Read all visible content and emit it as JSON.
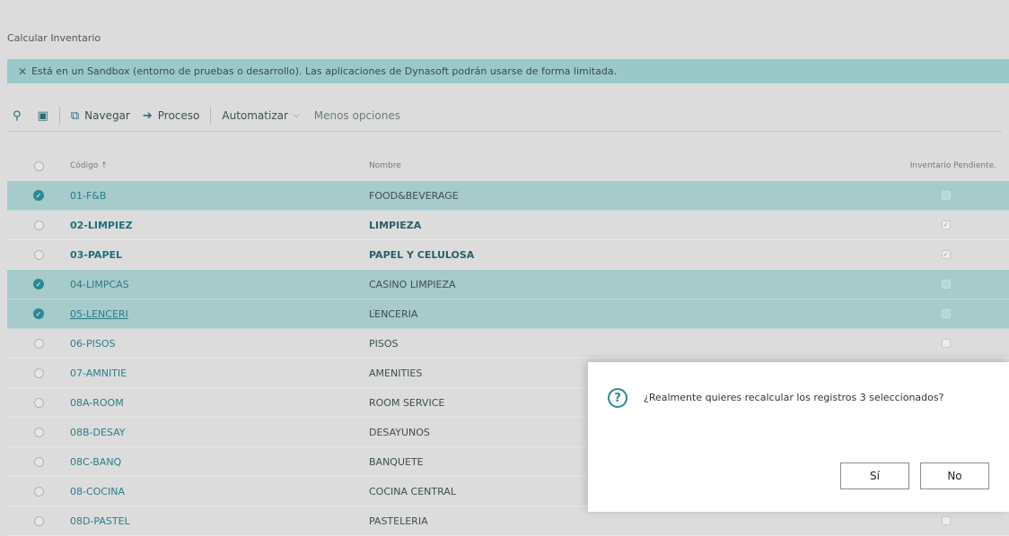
{
  "page": {
    "title": "Calcular Inventario"
  },
  "banner": {
    "close_icon": "close-icon",
    "text": "Está en un Sandbox (entorno de pruebas o desarrollo). Las aplicaciones de Dynasoft podrán usarse de forma limitada."
  },
  "toolbar": {
    "search_icon": "search-icon",
    "view_icon": "view-icon",
    "navegar": "Navegar",
    "proceso": "Proceso",
    "automatizar": "Automatizar",
    "menos": "Menos opciones"
  },
  "table": {
    "headers": {
      "code": "Código ↑",
      "name": "Nombre",
      "pending": "Inventario Pendiente."
    },
    "rows": [
      {
        "code": "01-F&B",
        "name": "FOOD&BEVERAGE"
      },
      {
        "code": "02-LIMPIEZ",
        "name": "LIMPIEZA"
      },
      {
        "code": "03-PAPEL",
        "name": "PAPEL Y CELULOSA"
      },
      {
        "code": "04-LIMPCAS",
        "name": "CASINO LIMPIEZA"
      },
      {
        "code": "05-LENCERI",
        "name": "LENCERIA"
      },
      {
        "code": "06-PISOS",
        "name": "PISOS"
      },
      {
        "code": "07-AMNITIE",
        "name": "AMENITIES"
      },
      {
        "code": "08A-ROOM",
        "name": "ROOM SERVICE"
      },
      {
        "code": "08B-DESAY",
        "name": "DESAYUNOS"
      },
      {
        "code": "08C-BANQ",
        "name": "BANQUETE"
      },
      {
        "code": "08-COCINA",
        "name": "COCINA CENTRAL"
      },
      {
        "code": "08D-PASTEL",
        "name": "PASTELERIA"
      }
    ]
  },
  "dialog": {
    "message": "¿Realmente quieres recalcular los registros 3 seleccionados?",
    "yes": "Sí",
    "no": "No"
  },
  "colors": {
    "accent": "#2b8a93",
    "selected_row": "#a7cacb",
    "banner": "#9bc9c9"
  }
}
